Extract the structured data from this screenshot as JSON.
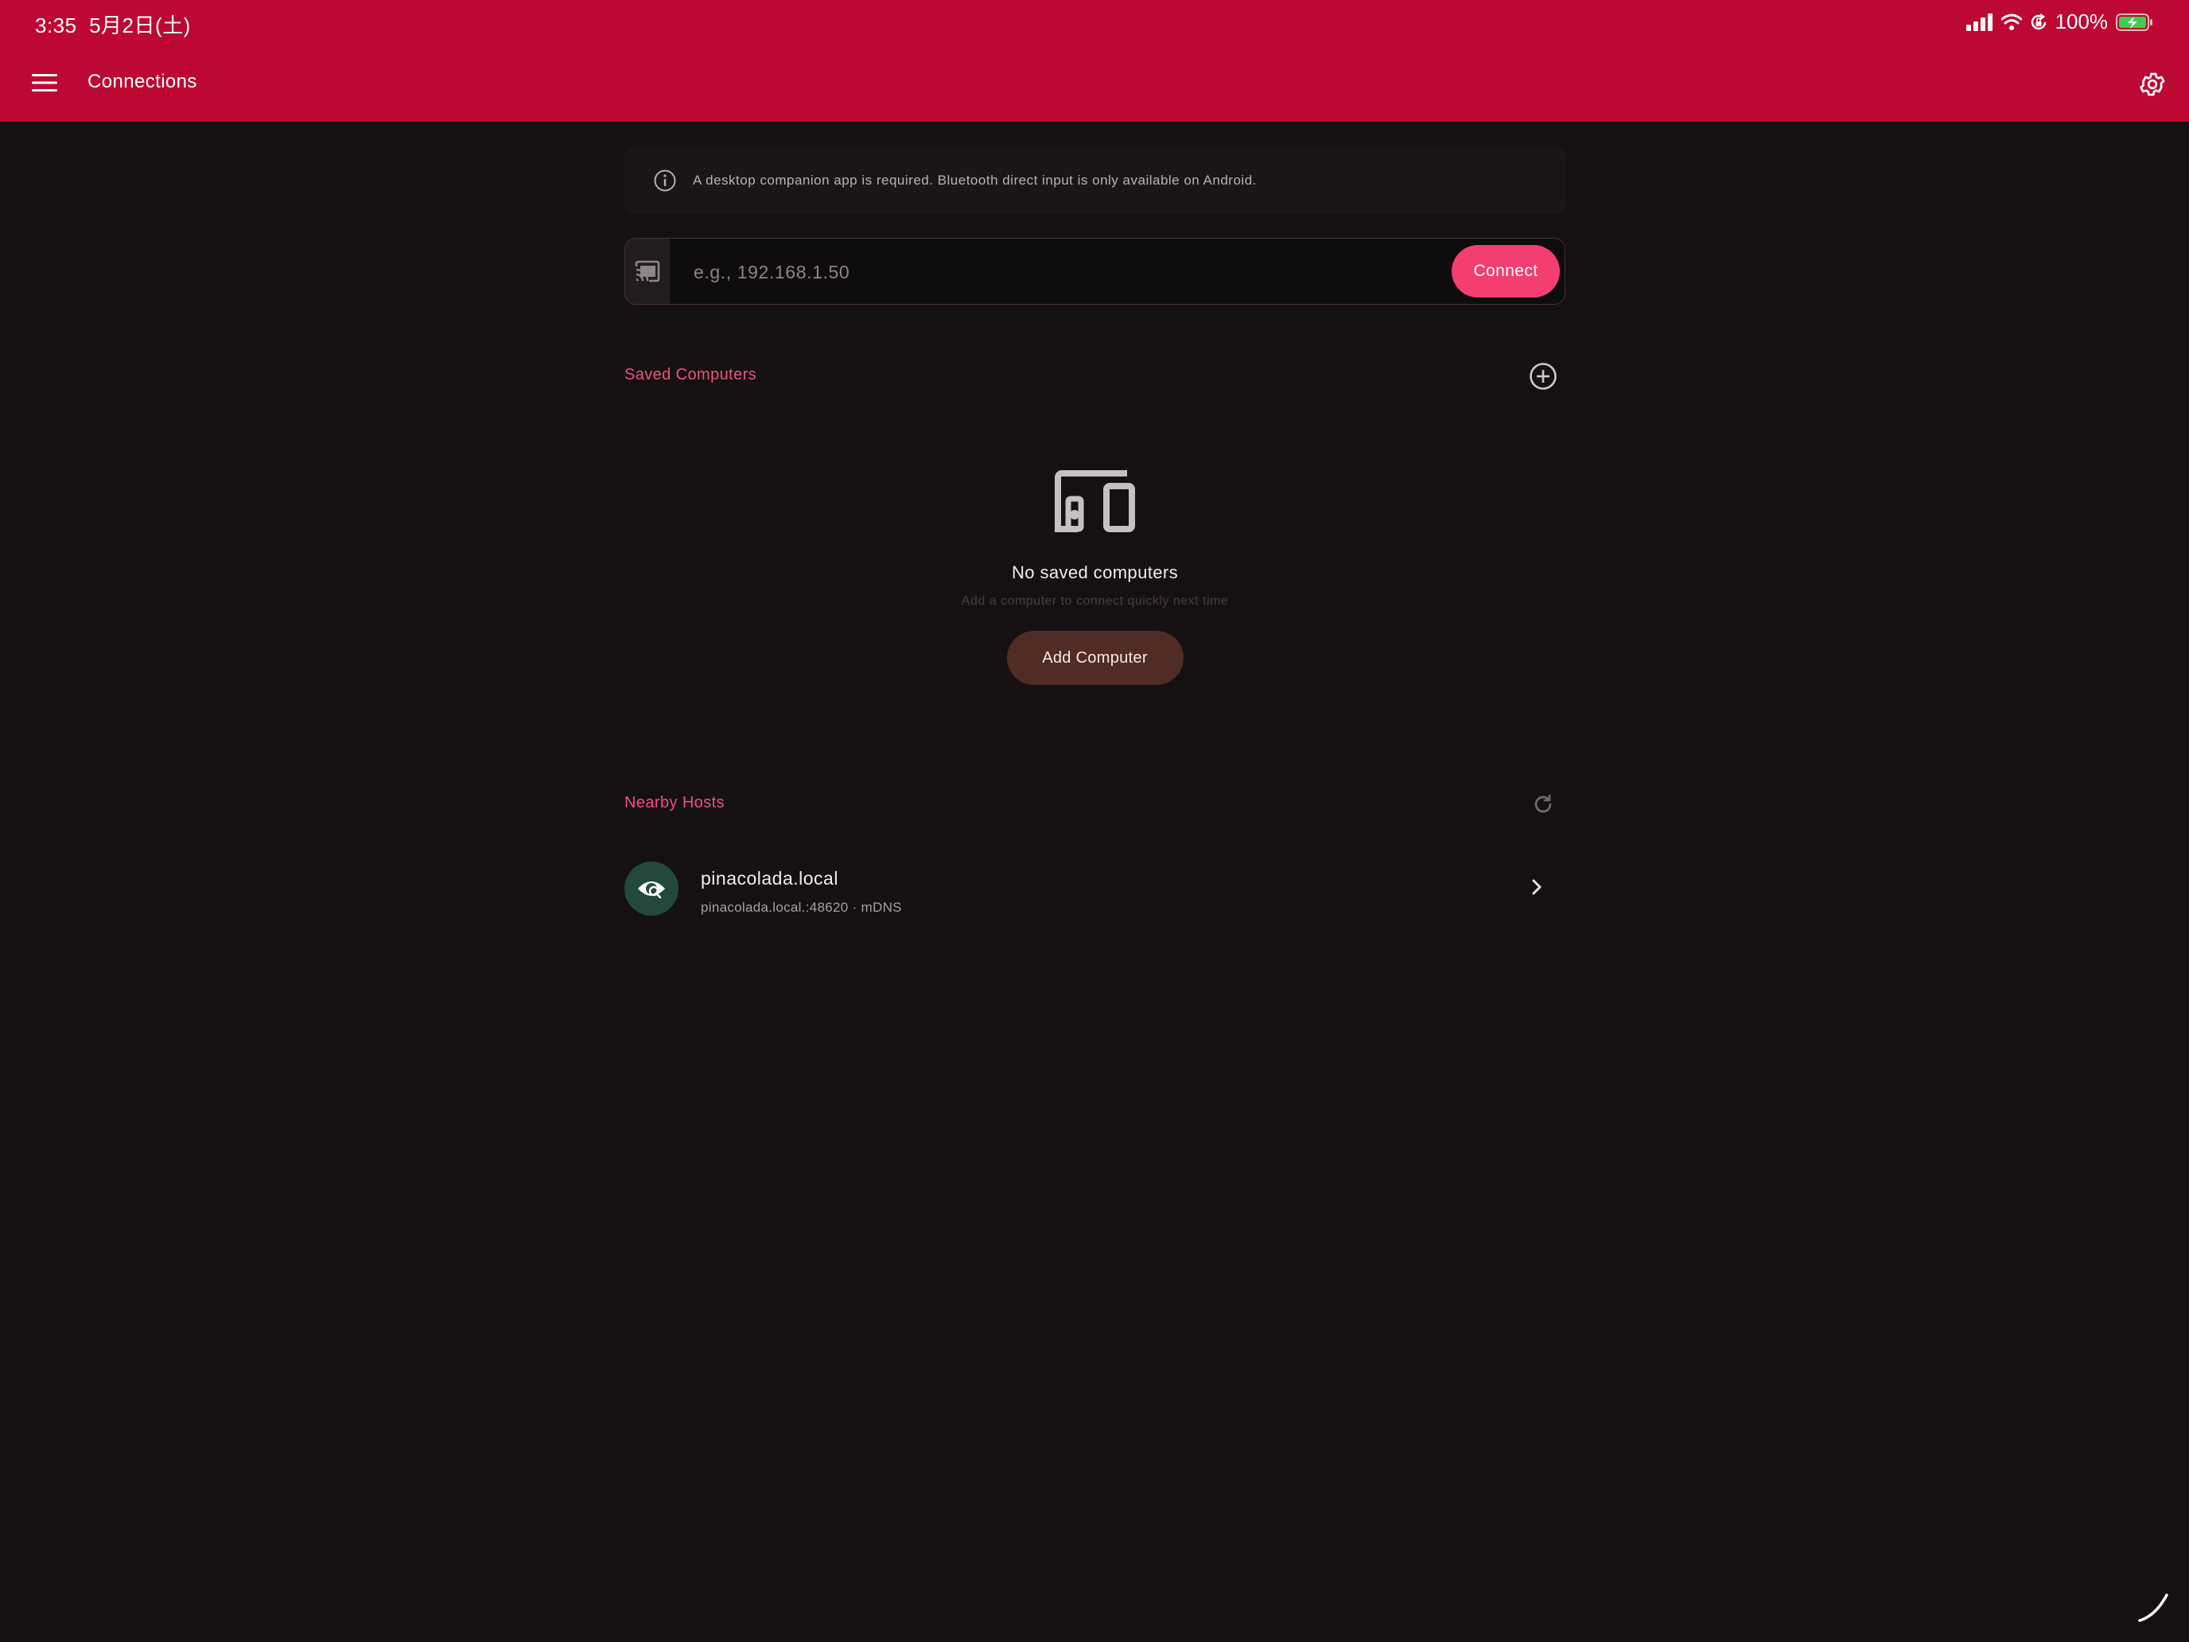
{
  "status_bar": {
    "time": "3:35",
    "date": "5月2日(土)",
    "battery": "100%",
    "icons": [
      "cellular-signal-icon",
      "wifi-icon",
      "orientation-lock-icon",
      "battery-charging-icon"
    ]
  },
  "app_bar": {
    "title": "Connections",
    "menu_icon": "hamburger-menu-icon",
    "settings_icon": "gear-icon",
    "background_color": "#bd0833"
  },
  "info_banner": {
    "icon": "info-icon",
    "text": "A desktop companion app is required. Bluetooth direct input is only available on Android."
  },
  "address_input": {
    "icon": "cast-icon",
    "placeholder": "e.g., 192.168.1.50",
    "value": "",
    "connect_label": "Connect",
    "accent_color": "#f33e6f"
  },
  "saved_computers": {
    "title": "Saved Computers",
    "action_icon": "add-circle-icon",
    "empty_icon": "devices-icon",
    "empty_title": "No saved computers",
    "empty_subtitle": "Add a computer to connect quickly next time",
    "add_button_label": "Add Computer"
  },
  "nearby_hosts": {
    "title": "Nearby Hosts",
    "action_icon": "refresh-icon",
    "hosts": [
      {
        "name": "pinacolada.local",
        "detail": "pinacolada.local.:48620 · mDNS",
        "icon": "network-discovery-icon",
        "chevron_icon": "chevron-right-icon"
      }
    ]
  }
}
